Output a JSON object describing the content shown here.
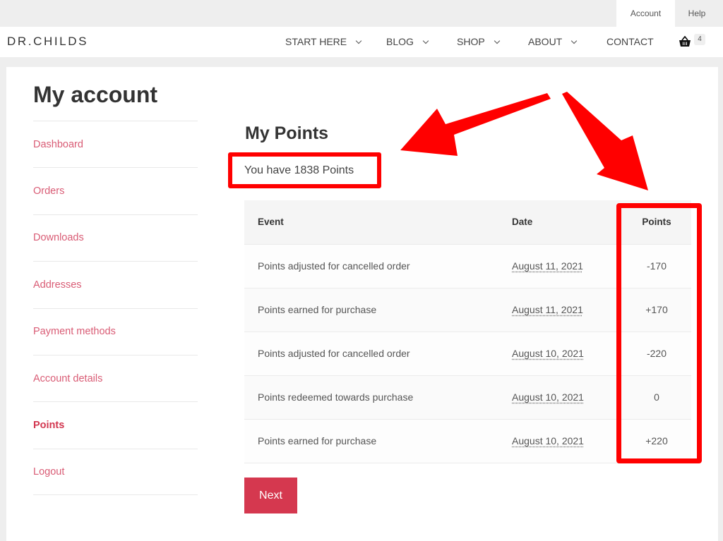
{
  "topbar": {
    "account_label": "Account",
    "help_label": "Help"
  },
  "header": {
    "logo": "DR.CHILDS",
    "nav": [
      {
        "label": "START HERE",
        "has_dropdown": true
      },
      {
        "label": "BLOG",
        "has_dropdown": true
      },
      {
        "label": "SHOP",
        "has_dropdown": true
      },
      {
        "label": "ABOUT",
        "has_dropdown": true
      },
      {
        "label": "CONTACT",
        "has_dropdown": false
      }
    ],
    "cart_icon": "shopping-basket-icon",
    "cart_count": "4"
  },
  "page": {
    "title": "My account"
  },
  "sidebar": {
    "items": [
      {
        "label": "Dashboard",
        "active": false
      },
      {
        "label": "Orders",
        "active": false
      },
      {
        "label": "Downloads",
        "active": false
      },
      {
        "label": "Addresses",
        "active": false
      },
      {
        "label": "Payment methods",
        "active": false
      },
      {
        "label": "Account details",
        "active": false
      },
      {
        "label": "Points",
        "active": true
      },
      {
        "label": "Logout",
        "active": false
      }
    ]
  },
  "points": {
    "title": "My Points",
    "summary": "You have 1838 Points",
    "table": {
      "headers": {
        "event": "Event",
        "date": "Date",
        "points": "Points"
      },
      "rows": [
        {
          "event": "Points adjusted for cancelled order",
          "date": "August 11, 2021",
          "points": "-170"
        },
        {
          "event": "Points earned for purchase",
          "date": "August 11, 2021",
          "points": "+170"
        },
        {
          "event": "Points adjusted for cancelled order",
          "date": "August 10, 2021",
          "points": "-220"
        },
        {
          "event": "Points redeemed towards purchase",
          "date": "August 10, 2021",
          "points": "0"
        },
        {
          "event": "Points earned for purchase",
          "date": "August 10, 2021",
          "points": "+220"
        }
      ]
    },
    "next_label": "Next"
  },
  "colors": {
    "accent": "#d5384f",
    "link": "#d95c75",
    "annotation": "#ff0000"
  }
}
